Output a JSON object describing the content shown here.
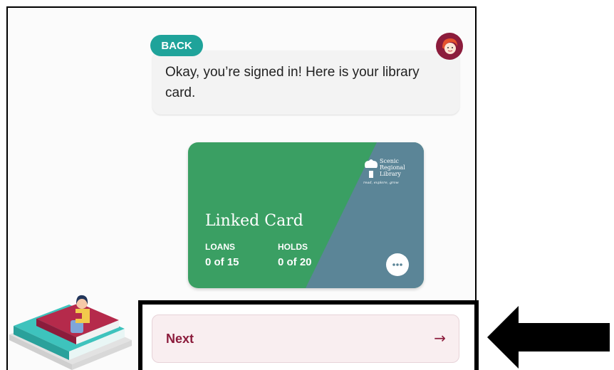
{
  "dialog": {
    "back_label": "BACK",
    "message": "Okay, you’re signed in! Here is your library card."
  },
  "card": {
    "title": "Linked Card",
    "loans_label": "LOANS",
    "loans_value": "0 of 15",
    "holds_label": "HOLDS",
    "holds_value": "0 of 20",
    "library_logo_lines": [
      "Scenic",
      "Regional",
      "Library"
    ],
    "library_tagline": "read, explore, grow",
    "colors": {
      "green": "#3a9f63",
      "slate": "#5b8597"
    }
  },
  "footer": {
    "next_label": "Next",
    "next_arrow": "→"
  },
  "icons": {
    "avatar": "libby-avatar-icon",
    "more": "more-options-icon",
    "pointer": "pointer-arrow-icon"
  },
  "colors": {
    "accent_teal": "#1fa39a",
    "next_text": "#8c1c3c"
  }
}
